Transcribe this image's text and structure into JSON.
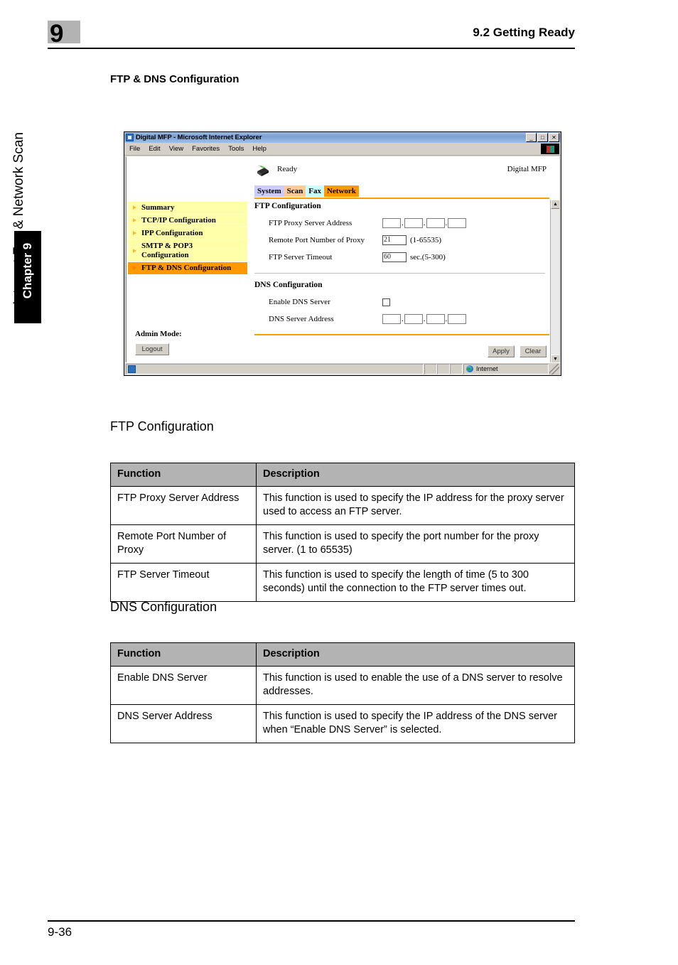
{
  "page": {
    "chapter_number": "9",
    "header_title": "9.2 Getting Ready",
    "chapter_tab_label": "Chapter 9",
    "side_running_title": "Internet Fax & Network Scan",
    "page_number": "9-36"
  },
  "headings": {
    "section": "FTP & DNS Configuration",
    "ftp_config": "FTP Configuration",
    "dns_config": "DNS Configuration"
  },
  "browser": {
    "title": "Digital MFP - Microsoft Internet Explorer",
    "title_icon": "ie-document-icon",
    "window_buttons": [
      {
        "name": "minimize-button",
        "glyph": "_"
      },
      {
        "name": "maximize-button",
        "glyph": "□"
      },
      {
        "name": "close-button",
        "glyph": "✕"
      }
    ],
    "menu_items": [
      "File",
      "Edit",
      "View",
      "Favorites",
      "Tools",
      "Help"
    ],
    "brand_icon": "windows-logo-icon",
    "status_bar": {
      "zone": "Internet",
      "zone_icon": "globe-icon",
      "doc_icon": "document-icon",
      "grip": "resize-grip-icon"
    }
  },
  "mfp": {
    "status_text": "Ready",
    "status_icon": "printer-icon",
    "brand_text": "Digital MFP",
    "tabs": [
      {
        "label": "System",
        "color": "#ccccff"
      },
      {
        "label": "Scan",
        "color": "#ffcc99"
      },
      {
        "label": "Fax",
        "color": "#ccffff"
      },
      {
        "label": "Network",
        "color": "#ff9900"
      }
    ],
    "accent_color": "#f5a000",
    "nav_items": [
      {
        "label": "Summary",
        "active": false
      },
      {
        "label": "TCP/IP Configuration",
        "active": false
      },
      {
        "label": "IPP Configuration",
        "active": false
      },
      {
        "label": "SMTP & POP3 Configuration",
        "active": false
      },
      {
        "label": "FTP & DNS Configuration",
        "active": true
      }
    ],
    "admin_label": "Admin Mode:",
    "logout_button": "Logout",
    "ftp_section": {
      "title": "FTP Configuration",
      "proxy_address_label": "FTP Proxy Server Address",
      "proxy_address_value": "",
      "remote_port_label": "Remote Port Number of Proxy",
      "remote_port_value": "21",
      "remote_port_hint": "(1-65535)",
      "timeout_label": "FTP Server Timeout",
      "timeout_value": "60",
      "timeout_hint": "sec.(5-300)"
    },
    "dns_section": {
      "title": "DNS Configuration",
      "enable_label": "Enable DNS Server",
      "enable_checked": false,
      "address_label": "DNS Server Address",
      "address_value": ""
    },
    "buttons": {
      "apply": "Apply",
      "clear": "Clear"
    },
    "scrollbar": {
      "up": "▲",
      "down": "▼"
    }
  },
  "tables": {
    "ftp": {
      "columns": [
        "Function",
        "Description"
      ],
      "rows": [
        [
          "FTP Proxy Server Address",
          "This function is used to specify the IP address for the proxy server used to access an FTP server."
        ],
        [
          "Remote Port Number of Proxy",
          "This function is used to specify the port number for the proxy server. (1 to 65535)"
        ],
        [
          "FTP Server Timeout",
          "This function is used to specify the length of time (5 to 300 seconds) until the connection to the FTP server times out."
        ]
      ]
    },
    "dns": {
      "columns": [
        "Function",
        "Description"
      ],
      "rows": [
        [
          "Enable DNS Server",
          "This function is used to enable the use of a DNS server to resolve addresses."
        ],
        [
          "DNS Server Address",
          "This function is used to specify the IP address of the DNS server when “Enable DNS Server” is selected."
        ]
      ]
    }
  }
}
